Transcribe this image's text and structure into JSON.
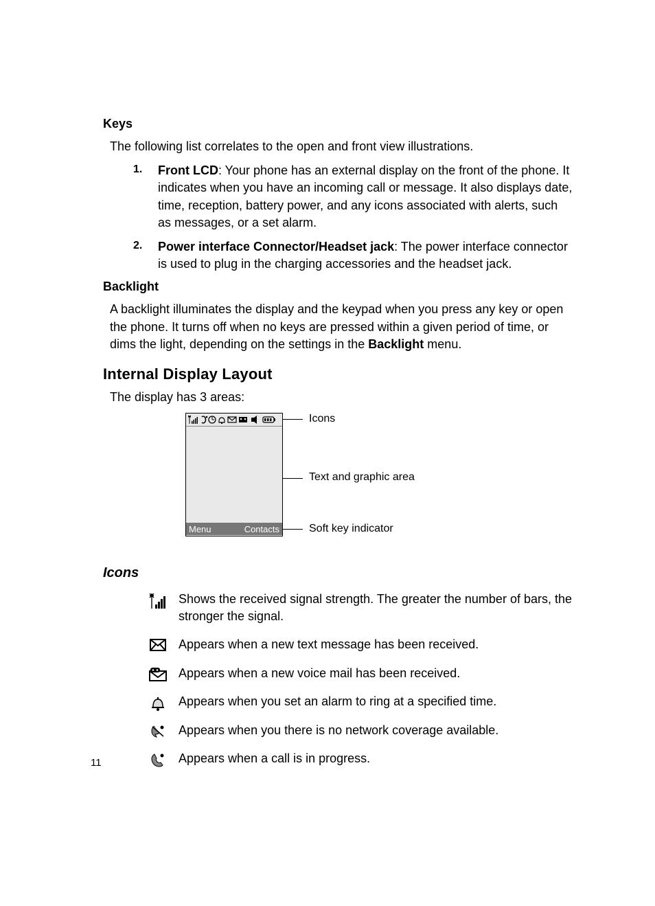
{
  "sections": {
    "keys": {
      "heading": "Keys",
      "intro": "The following list correlates to the open and front view illustrations.",
      "items": [
        {
          "num": "1.",
          "label": "Front LCD",
          "text": ": Your phone has an external display on the front of the phone. It indicates when you have an incoming call or message. It also displays date, time, reception, battery power, and any icons associated with alerts, such as messages, or a set alarm."
        },
        {
          "num": "2.",
          "label": "Power interface Connector/Headset jack",
          "text": ": The power interface connector is used to plug in the charging accessories and the headset jack."
        }
      ]
    },
    "backlight": {
      "heading": "Backlight",
      "text_a": "A backlight illuminates the display and the keypad when you press any key or open the phone. It turns off when no keys are pressed within a given period of time, or dims the light, depending on the settings in the ",
      "bold": "Backlight",
      "text_b": " menu."
    },
    "layout": {
      "heading": "Internal Display Layout",
      "intro": "The display has 3 areas:",
      "diagram": {
        "softkey_left": "Menu",
        "softkey_right": "Contacts",
        "callout_icons": "Icons",
        "callout_text": "Text and graphic area",
        "callout_soft": "Soft key indicator"
      }
    },
    "icons": {
      "heading": "Icons",
      "rows": [
        {
          "name": "signal-icon",
          "desc": "Shows the received signal strength. The greater the number of bars, the stronger the signal."
        },
        {
          "name": "message-icon",
          "desc": "Appears when a new text message has been received."
        },
        {
          "name": "voicemail-icon",
          "desc": "Appears when a new voice mail has been received."
        },
        {
          "name": "alarm-icon",
          "desc": "Appears when you set an alarm to ring at a specified time."
        },
        {
          "name": "no-network-icon",
          "desc": "Appears when you there is no network coverage available."
        },
        {
          "name": "call-icon",
          "desc": "Appears when a call is in progress."
        }
      ]
    }
  },
  "page_number": "11"
}
